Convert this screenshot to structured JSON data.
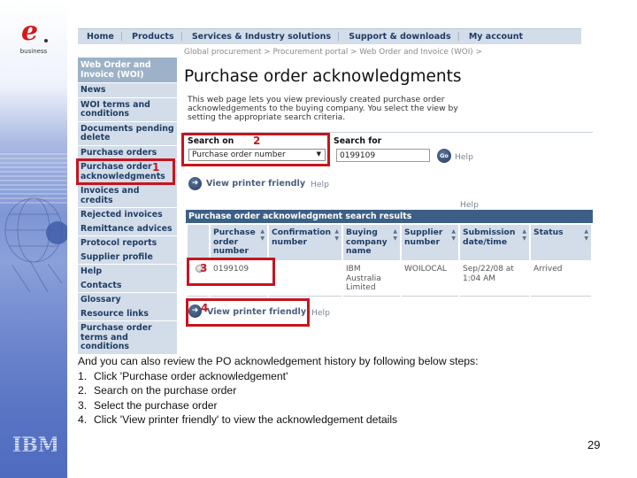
{
  "banner": {
    "brand_mark": "e",
    "brand_text": "business",
    "footer_logo": "IBM"
  },
  "topnav": {
    "items": [
      "Home",
      "Products",
      "Services & Industry solutions",
      "Support & downloads",
      "My account"
    ]
  },
  "sidebar": {
    "items": [
      {
        "label": "Web Order and Invoice (WOI)",
        "type": "header"
      },
      {
        "label": "News"
      },
      {
        "label": "WOI terms and conditions"
      },
      {
        "label": "Documents pending delete"
      },
      {
        "label": "Purchase orders"
      },
      {
        "label": "Purchase order acknowledgments",
        "selected": true
      },
      {
        "label": "Invoices and credits"
      },
      {
        "label": "Rejected invoices"
      },
      {
        "label": "Remittance advices"
      },
      {
        "label": "Protocol reports"
      },
      {
        "label": "Supplier profile"
      },
      {
        "label": "Help"
      },
      {
        "label": "Contacts"
      },
      {
        "label": "Glossary"
      },
      {
        "label": "Resource links"
      },
      {
        "label": "Purchase order terms and conditions"
      }
    ]
  },
  "main": {
    "breadcrumb": "Global procurement > Procurement portal > Web Order and Invoice (WOI) >",
    "title": "Purchase order acknowledgments",
    "intro": "This web page lets you view previously created purchase order acknowledgements to the buying company. You select the view by setting the appropriate search criteria.",
    "search": {
      "search_on_label": "Search on",
      "search_on_value": "Purchase order number",
      "search_for_label": "Search for",
      "search_for_value": "0199109",
      "go_label": "Go",
      "help_label": "Help"
    },
    "printer_link": "View printer friendly",
    "printer_help": "Help",
    "results_help": "Help",
    "results": {
      "title": "Purchase order acknowledgment search results",
      "columns": [
        "",
        "Purchase order number",
        "Confirmation number",
        "Buying company name",
        "Supplier number",
        "Submission date/time",
        "Status"
      ],
      "rows": [
        {
          "po_number": "0199109",
          "confirmation_number": "",
          "buying_company": "IBM Australia Limited",
          "supplier_number": "WOILOCAL",
          "submission": "Sep/22/08 at 1:04 AM",
          "status": "Arrived"
        }
      ]
    },
    "bottom_printer_link": "View printer friendly",
    "bottom_help": "Help"
  },
  "annotations": [
    "1",
    "2",
    "3",
    "4"
  ],
  "instructions": {
    "intro": "And you can also review the PO acknowledgement history by following below steps:",
    "steps": [
      {
        "n": "1.",
        "text": "Click 'Purchase order acknowledgement'"
      },
      {
        "n": "2.",
        "text": "Search on the purchase order"
      },
      {
        "n": "3.",
        "text": "Select the purchase order"
      },
      {
        "n": "4.",
        "text": "Click 'View printer friendly' to view the acknowledgement details"
      }
    ]
  },
  "page_number": "29",
  "colors": {
    "accent_red": "#c8141e",
    "nav_bg": "#d3dde9",
    "nav_text": "#1f3d66",
    "results_header_bg": "#3d5f86"
  }
}
